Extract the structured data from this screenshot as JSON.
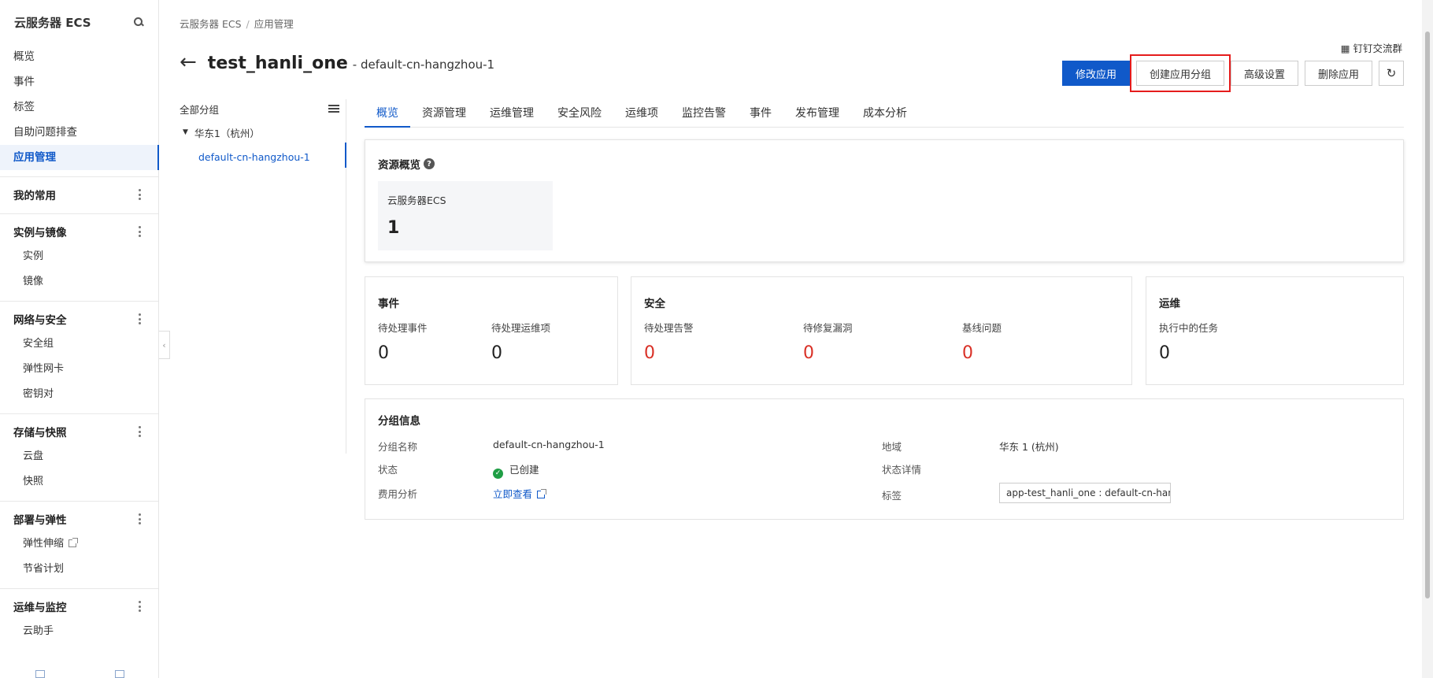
{
  "sidebar": {
    "title": "云服务器 ECS",
    "top_items": [
      {
        "label": "概览"
      },
      {
        "label": "事件"
      },
      {
        "label": "标签"
      },
      {
        "label": "自助问题排查"
      },
      {
        "label": "应用管理"
      }
    ],
    "groups": [
      {
        "label": "我的常用",
        "items": []
      },
      {
        "label": "实例与镜像",
        "items": [
          "实例",
          "镜像"
        ]
      },
      {
        "label": "网络与安全",
        "items": [
          "安全组",
          "弹性网卡",
          "密钥对"
        ]
      },
      {
        "label": "存储与快照",
        "items": [
          "云盘",
          "快照"
        ]
      },
      {
        "label": "部署与弹性",
        "items": [
          "弹性伸缩",
          "节省计划"
        ]
      },
      {
        "label": "运维与监控",
        "items": [
          "云助手"
        ]
      }
    ]
  },
  "breadcrumb": [
    "云服务器 ECS",
    "应用管理"
  ],
  "header": {
    "app_name": "test_hanli_one",
    "group_name": "- default-cn-hangzhou-1",
    "dingtalk": "钉钉交流群",
    "buttons": {
      "edit": "修改应用",
      "create_group": "创建应用分组",
      "advanced": "高级设置",
      "delete": "删除应用"
    }
  },
  "tree": {
    "header": "全部分组",
    "region": "华东1（杭州）",
    "group": "default-cn-hangzhou-1"
  },
  "tabs": [
    "概览",
    "资源管理",
    "运维管理",
    "安全风险",
    "运维项",
    "监控告警",
    "事件",
    "发布管理",
    "成本分析"
  ],
  "resource_overview": {
    "title": "资源概览",
    "tile_label": "云服务器ECS",
    "tile_value": "1"
  },
  "events_card": {
    "title": "事件",
    "pending_events_label": "待处理事件",
    "pending_events_value": "0",
    "pending_ops_label": "待处理运维项",
    "pending_ops_value": "0"
  },
  "security_card": {
    "title": "安全",
    "alerts_label": "待处理告警",
    "alerts_value": "0",
    "vulns_label": "待修复漏洞",
    "vulns_value": "0",
    "baseline_label": "基线问题",
    "baseline_value": "0"
  },
  "ops_card": {
    "title": "运维",
    "running_tasks_label": "执行中的任务",
    "running_tasks_value": "0"
  },
  "group_info": {
    "title": "分组信息",
    "name_label": "分组名称",
    "name_value": "default-cn-hangzhou-1",
    "status_label": "状态",
    "status_value": "已创建",
    "cost_label": "费用分析",
    "cost_link": "立即查看",
    "region_label": "地域",
    "region_value": "华东 1 (杭州)",
    "status_detail_label": "状态详情",
    "tag_label": "标签",
    "tag_value": "app-test_hanli_one : default-cn-han..."
  },
  "colors": {
    "primary": "#1059c9",
    "danger": "#d93026",
    "success": "#1f9e45",
    "highlight": "#e51c1c"
  }
}
